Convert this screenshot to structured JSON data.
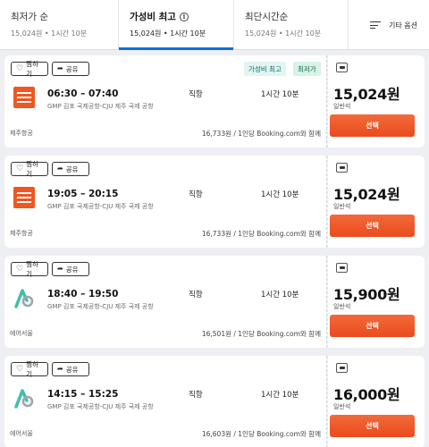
{
  "sort_tabs": [
    {
      "title": "최저가 순",
      "sub": "15,024원 • 1시간 10분"
    },
    {
      "title": "가성비 최고",
      "sub": "15,024원 • 1시간 10분"
    },
    {
      "title": "최단시간순",
      "sub": "15,024원 • 1시간 10분"
    }
  ],
  "more_options": "기타 옵션",
  "common": {
    "save": "찜하기",
    "share": "공유",
    "select": "선택",
    "cabin": "일반석",
    "stops": "직항",
    "route": "GMP 김포 국제공항-CJU 제주 국제 공항"
  },
  "badges": {
    "best": "가성비 최고",
    "cheap": "최저가"
  },
  "flights": [
    {
      "times": "06:30 – 07:40",
      "duration": "1시간 10분",
      "airline": "제주항공",
      "logo": "jeju-air-logo",
      "note": "16,733원 / 1인당 Booking.com와 함께",
      "price": "15,024원"
    },
    {
      "times": "19:05 – 20:15",
      "duration": "1시간 10분",
      "airline": "제주항공",
      "logo": "jeju-air-logo",
      "note": "16,733원 / 1인당 Booking.com와 함께",
      "price": "15,024원"
    },
    {
      "times": "18:40 – 19:50",
      "duration": "1시간 10분",
      "airline": "에어서울",
      "logo": "air-seoul-logo",
      "note": "16,501원 / 1인당 Booking.com와 함께",
      "price": "15,900원"
    },
    {
      "times": "14:15 – 15:25",
      "duration": "1시간 10분",
      "airline": "에어서울",
      "logo": "air-seoul-logo",
      "note": "16,603원 / 1인당 Booking.com와 함께",
      "price": "16,000원"
    }
  ],
  "colors": {
    "accent": "#0770e3",
    "select": "#ea4b1d",
    "jeju": "#ee5622",
    "air_seoul": "#3fbfaa"
  }
}
